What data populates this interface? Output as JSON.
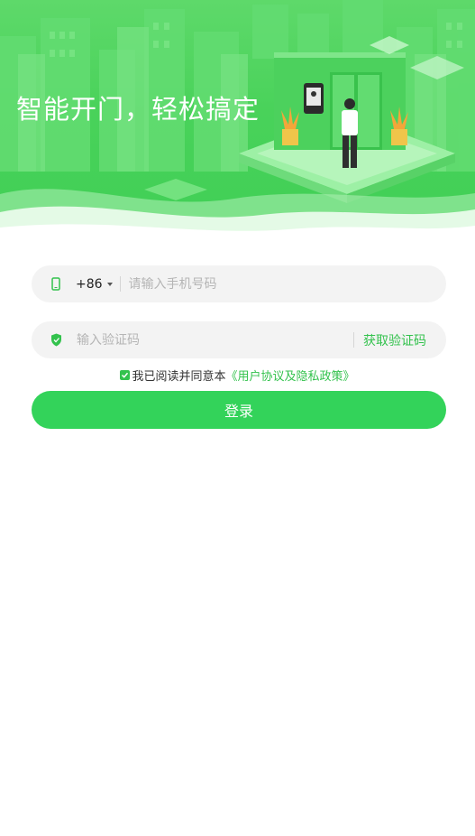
{
  "banner": {
    "slogan": "智能开门，轻松搞定"
  },
  "phone": {
    "country_code": "+86",
    "placeholder": "请输入手机号码",
    "value": ""
  },
  "code": {
    "placeholder": "输入验证码",
    "value": "",
    "get_code_label": "获取验证码"
  },
  "agreement": {
    "checked": true,
    "text": "我已阅读并同意本",
    "policy_link": "《用户协议及隐私政策》"
  },
  "login": {
    "label": "登录"
  },
  "colors": {
    "accent": "#33c24d",
    "button": "#33d35a",
    "field_bg": "#f3f3f3"
  }
}
